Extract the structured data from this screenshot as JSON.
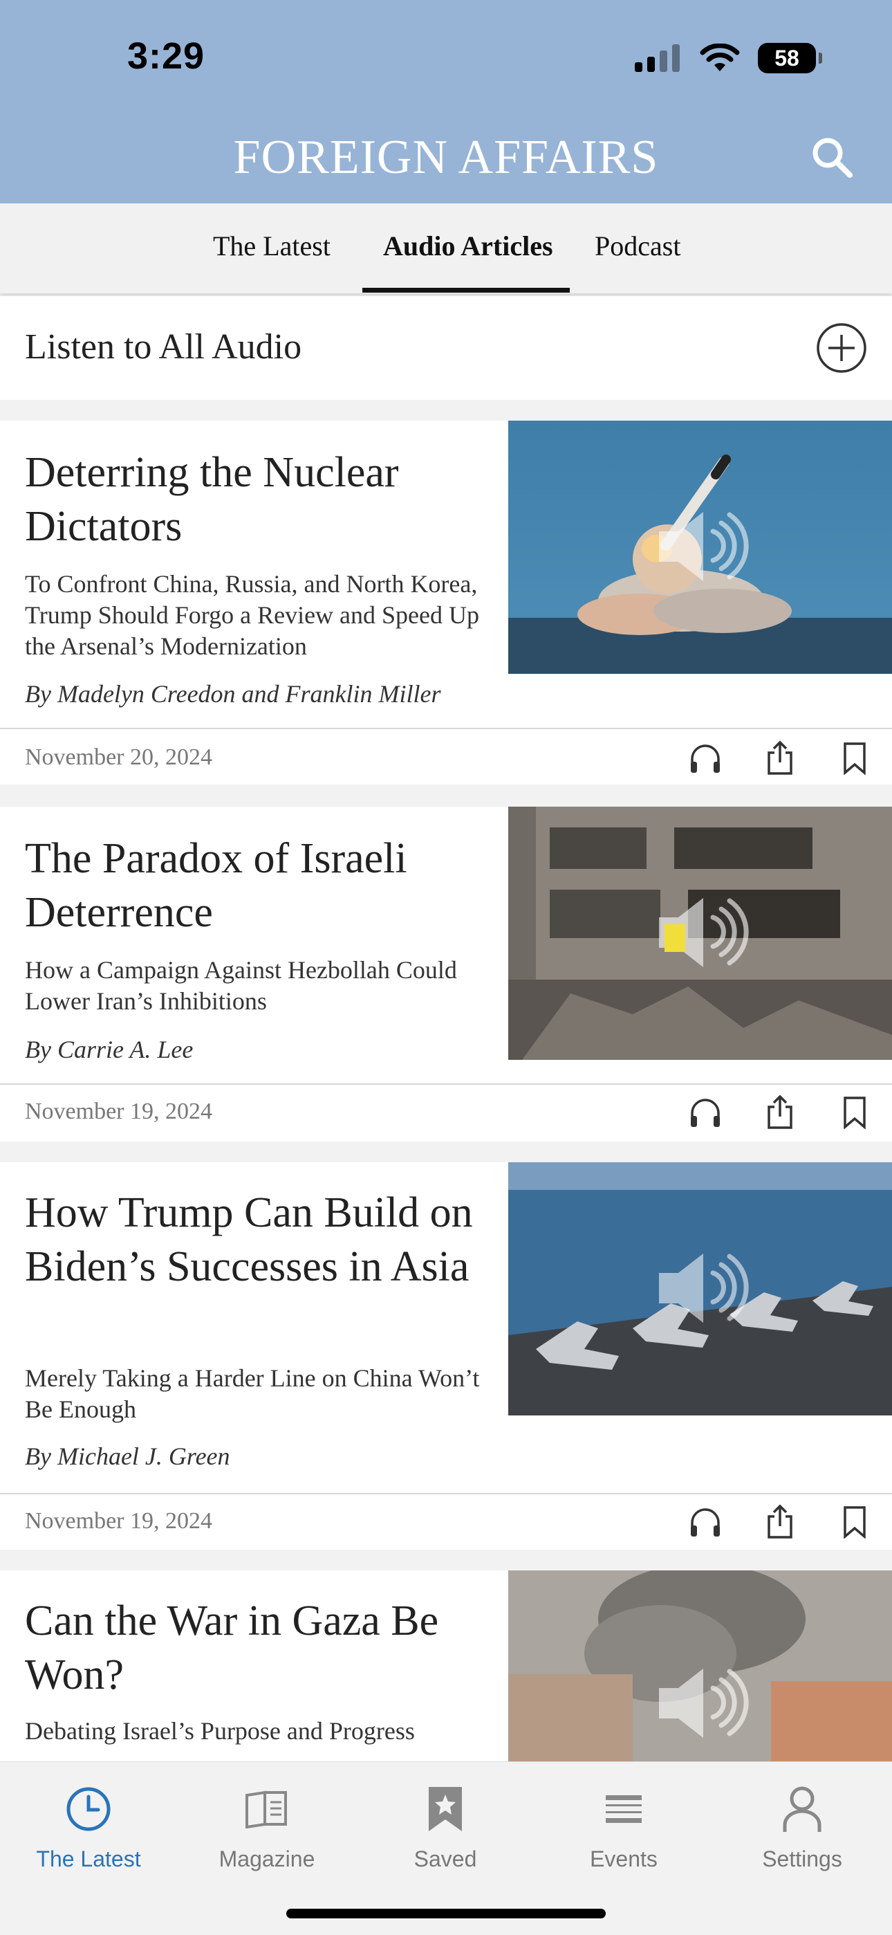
{
  "status_bar": {
    "time": "3:29",
    "battery": "58"
  },
  "header": {
    "brand": "FOREIGN AFFAIRS"
  },
  "tabs": [
    {
      "label": "The Latest",
      "active": false
    },
    {
      "label": "Audio Articles",
      "active": true
    },
    {
      "label": "Podcast",
      "active": false
    }
  ],
  "listen_all": {
    "label": "Listen to All Audio"
  },
  "articles": [
    {
      "title": "Deterring the Nuclear Dictators",
      "subtitle": "To Confront China, Russia, and North Korea, Trump Should Forgo a Review and Speed Up the Arsenal’s Modernization",
      "author": "By Madelyn Creedon and Franklin Miller",
      "date": "November 20, 2024"
    },
    {
      "title": "The Paradox of Israeli Deterrence",
      "subtitle": "How a Campaign Against Hezbollah Could Lower Iran’s Inhibitions",
      "author": "By Carrie A. Lee",
      "date": "November 19, 2024"
    },
    {
      "title": "How Trump Can Build on Biden’s Successes in Asia",
      "subtitle": "Merely Taking a Harder Line on China Won’t Be Enough",
      "author": "By Michael J. Green",
      "date": "November 19, 2024"
    },
    {
      "title": "Can the War in Gaza Be Won?",
      "subtitle": "Debating Israel’s Purpose and Progress"
    }
  ],
  "tabbar": [
    {
      "label": "The Latest",
      "icon": "clock-icon",
      "active": true
    },
    {
      "label": "Magazine",
      "icon": "magazine-icon"
    },
    {
      "label": "Saved",
      "icon": "bookmark-star-icon"
    },
    {
      "label": "Events",
      "icon": "events-icon"
    },
    {
      "label": "Settings",
      "icon": "person-icon"
    }
  ],
  "colors": {
    "header_bg": "#97b4d7",
    "active_tab": "#2a74b8"
  }
}
